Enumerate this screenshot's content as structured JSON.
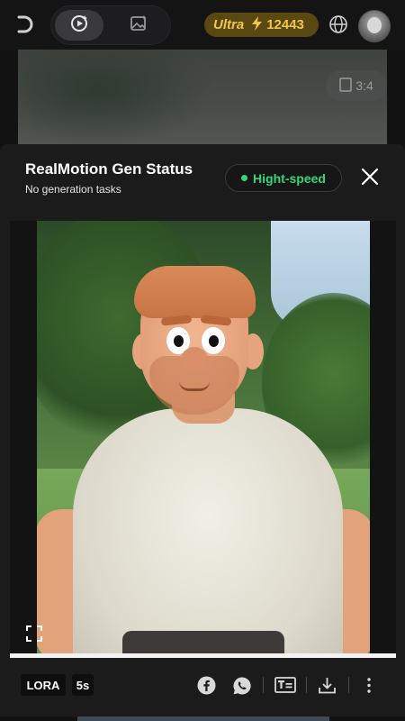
{
  "topbar": {
    "plan_label": "Ultra",
    "credits": "12443",
    "icons": [
      "back-icon",
      "video-mode-icon",
      "image-mode-icon",
      "bolt-icon",
      "globe-icon",
      "avatar"
    ]
  },
  "background_card": {
    "ratio_label": "3:4"
  },
  "modal": {
    "title": "RealMotion Gen Status",
    "subtitle": "No generation tasks",
    "speed_badge": "Hight-speed",
    "speed_color": "#33d67a"
  },
  "video": {
    "progress": 1.0
  },
  "toolbar": {
    "tag_model": "LORA",
    "tag_duration": "5s",
    "icons": [
      "facebook-icon",
      "whatsapp-icon",
      "subtitle-icon",
      "download-icon",
      "more-icon"
    ]
  },
  "colors": {
    "background": "#121213",
    "modal": "#1b1b1c",
    "gold": "#f0c64a",
    "gold_bg": "#5a4813"
  }
}
